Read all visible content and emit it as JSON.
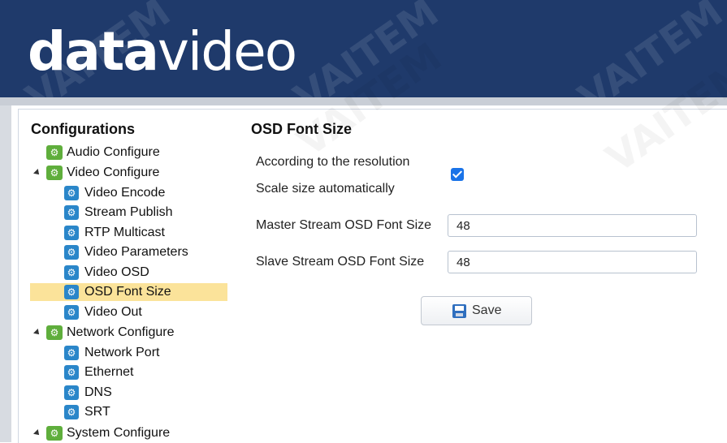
{
  "header": {
    "logo_bold": "data",
    "logo_thin": "video",
    "watermark": "VAITEM"
  },
  "sidebar": {
    "title": "Configurations",
    "items": [
      {
        "label": "Audio Configure"
      },
      {
        "label": "Video Configure"
      },
      {
        "label": "Video Encode"
      },
      {
        "label": "Stream Publish"
      },
      {
        "label": "RTP Multicast"
      },
      {
        "label": "Video Parameters"
      },
      {
        "label": "Video OSD"
      },
      {
        "label": "OSD Font Size"
      },
      {
        "label": "Video Out"
      },
      {
        "label": "Network Configure"
      },
      {
        "label": "Network Port"
      },
      {
        "label": "Ethernet"
      },
      {
        "label": "DNS"
      },
      {
        "label": "SRT"
      },
      {
        "label": "System Configure"
      }
    ]
  },
  "main": {
    "title": "OSD Font Size",
    "resolution_label_line1": "According to the resolution",
    "resolution_label_line2": "Scale size automatically",
    "auto_scale_checked": true,
    "master_label": "Master Stream OSD Font Size",
    "master_value": "48",
    "slave_label": "Slave Stream OSD Font Size",
    "slave_value": "48",
    "save_label": "Save"
  },
  "colors": {
    "header_bg": "#1f3a6b",
    "selected_bg": "#fbe39a",
    "group_icon": "#5fae3c",
    "leaf_icon": "#2a86c9",
    "checkbox": "#1a73e8"
  },
  "icons": {
    "group": "gear-green-icon",
    "leaf": "gear-blue-icon",
    "save": "floppy-disk-icon",
    "expand": "triangle-expanded-icon"
  }
}
